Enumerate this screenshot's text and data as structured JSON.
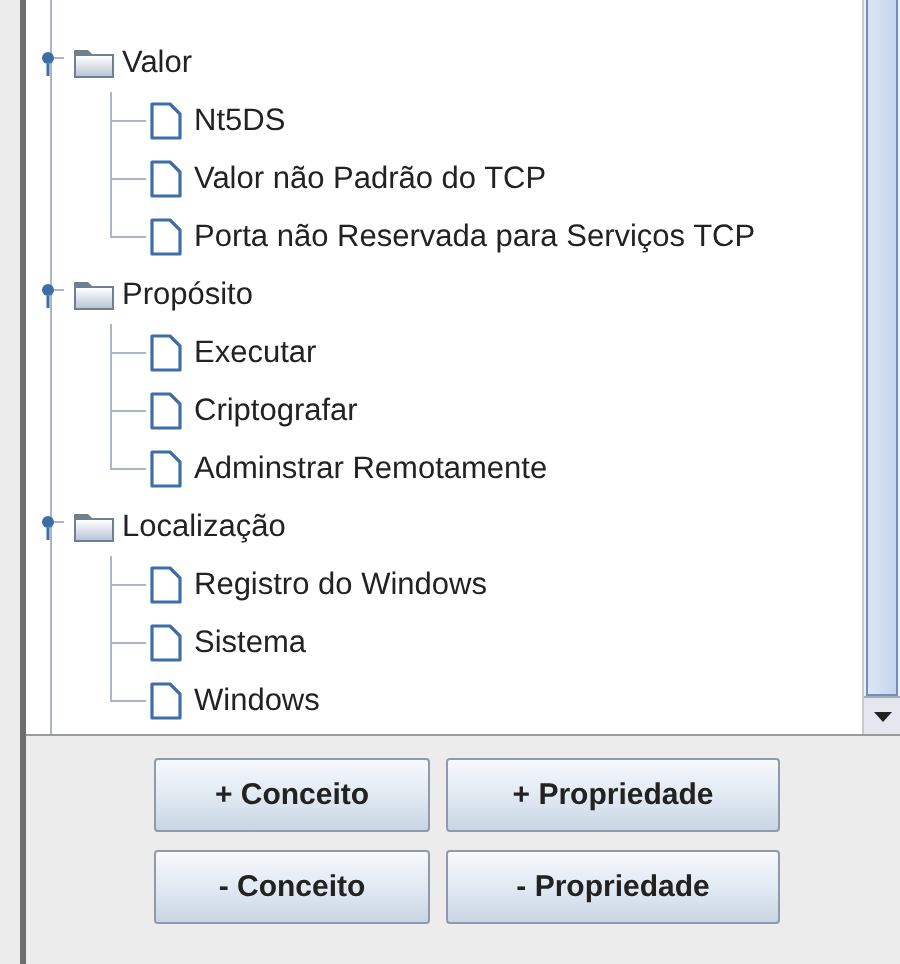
{
  "tree": [
    {
      "label": "Valor",
      "expanded": true,
      "children": [
        {
          "label": "Nt5DS"
        },
        {
          "label": "Valor não Padrão do TCP"
        },
        {
          "label": "Porta não Reservada para Serviços TCP"
        }
      ]
    },
    {
      "label": "Propósito",
      "expanded": true,
      "children": [
        {
          "label": "Executar"
        },
        {
          "label": "Criptografar"
        },
        {
          "label": "Adminstrar Remotamente"
        }
      ]
    },
    {
      "label": "Localização",
      "expanded": true,
      "children": [
        {
          "label": "Registro do Windows"
        },
        {
          "label": "Sistema"
        },
        {
          "label": "Windows"
        }
      ]
    }
  ],
  "buttons": [
    {
      "label": "+ Conceito"
    },
    {
      "label": "+ Propriedade"
    },
    {
      "label": "- Conceito"
    },
    {
      "label": "- Propriedade"
    }
  ]
}
